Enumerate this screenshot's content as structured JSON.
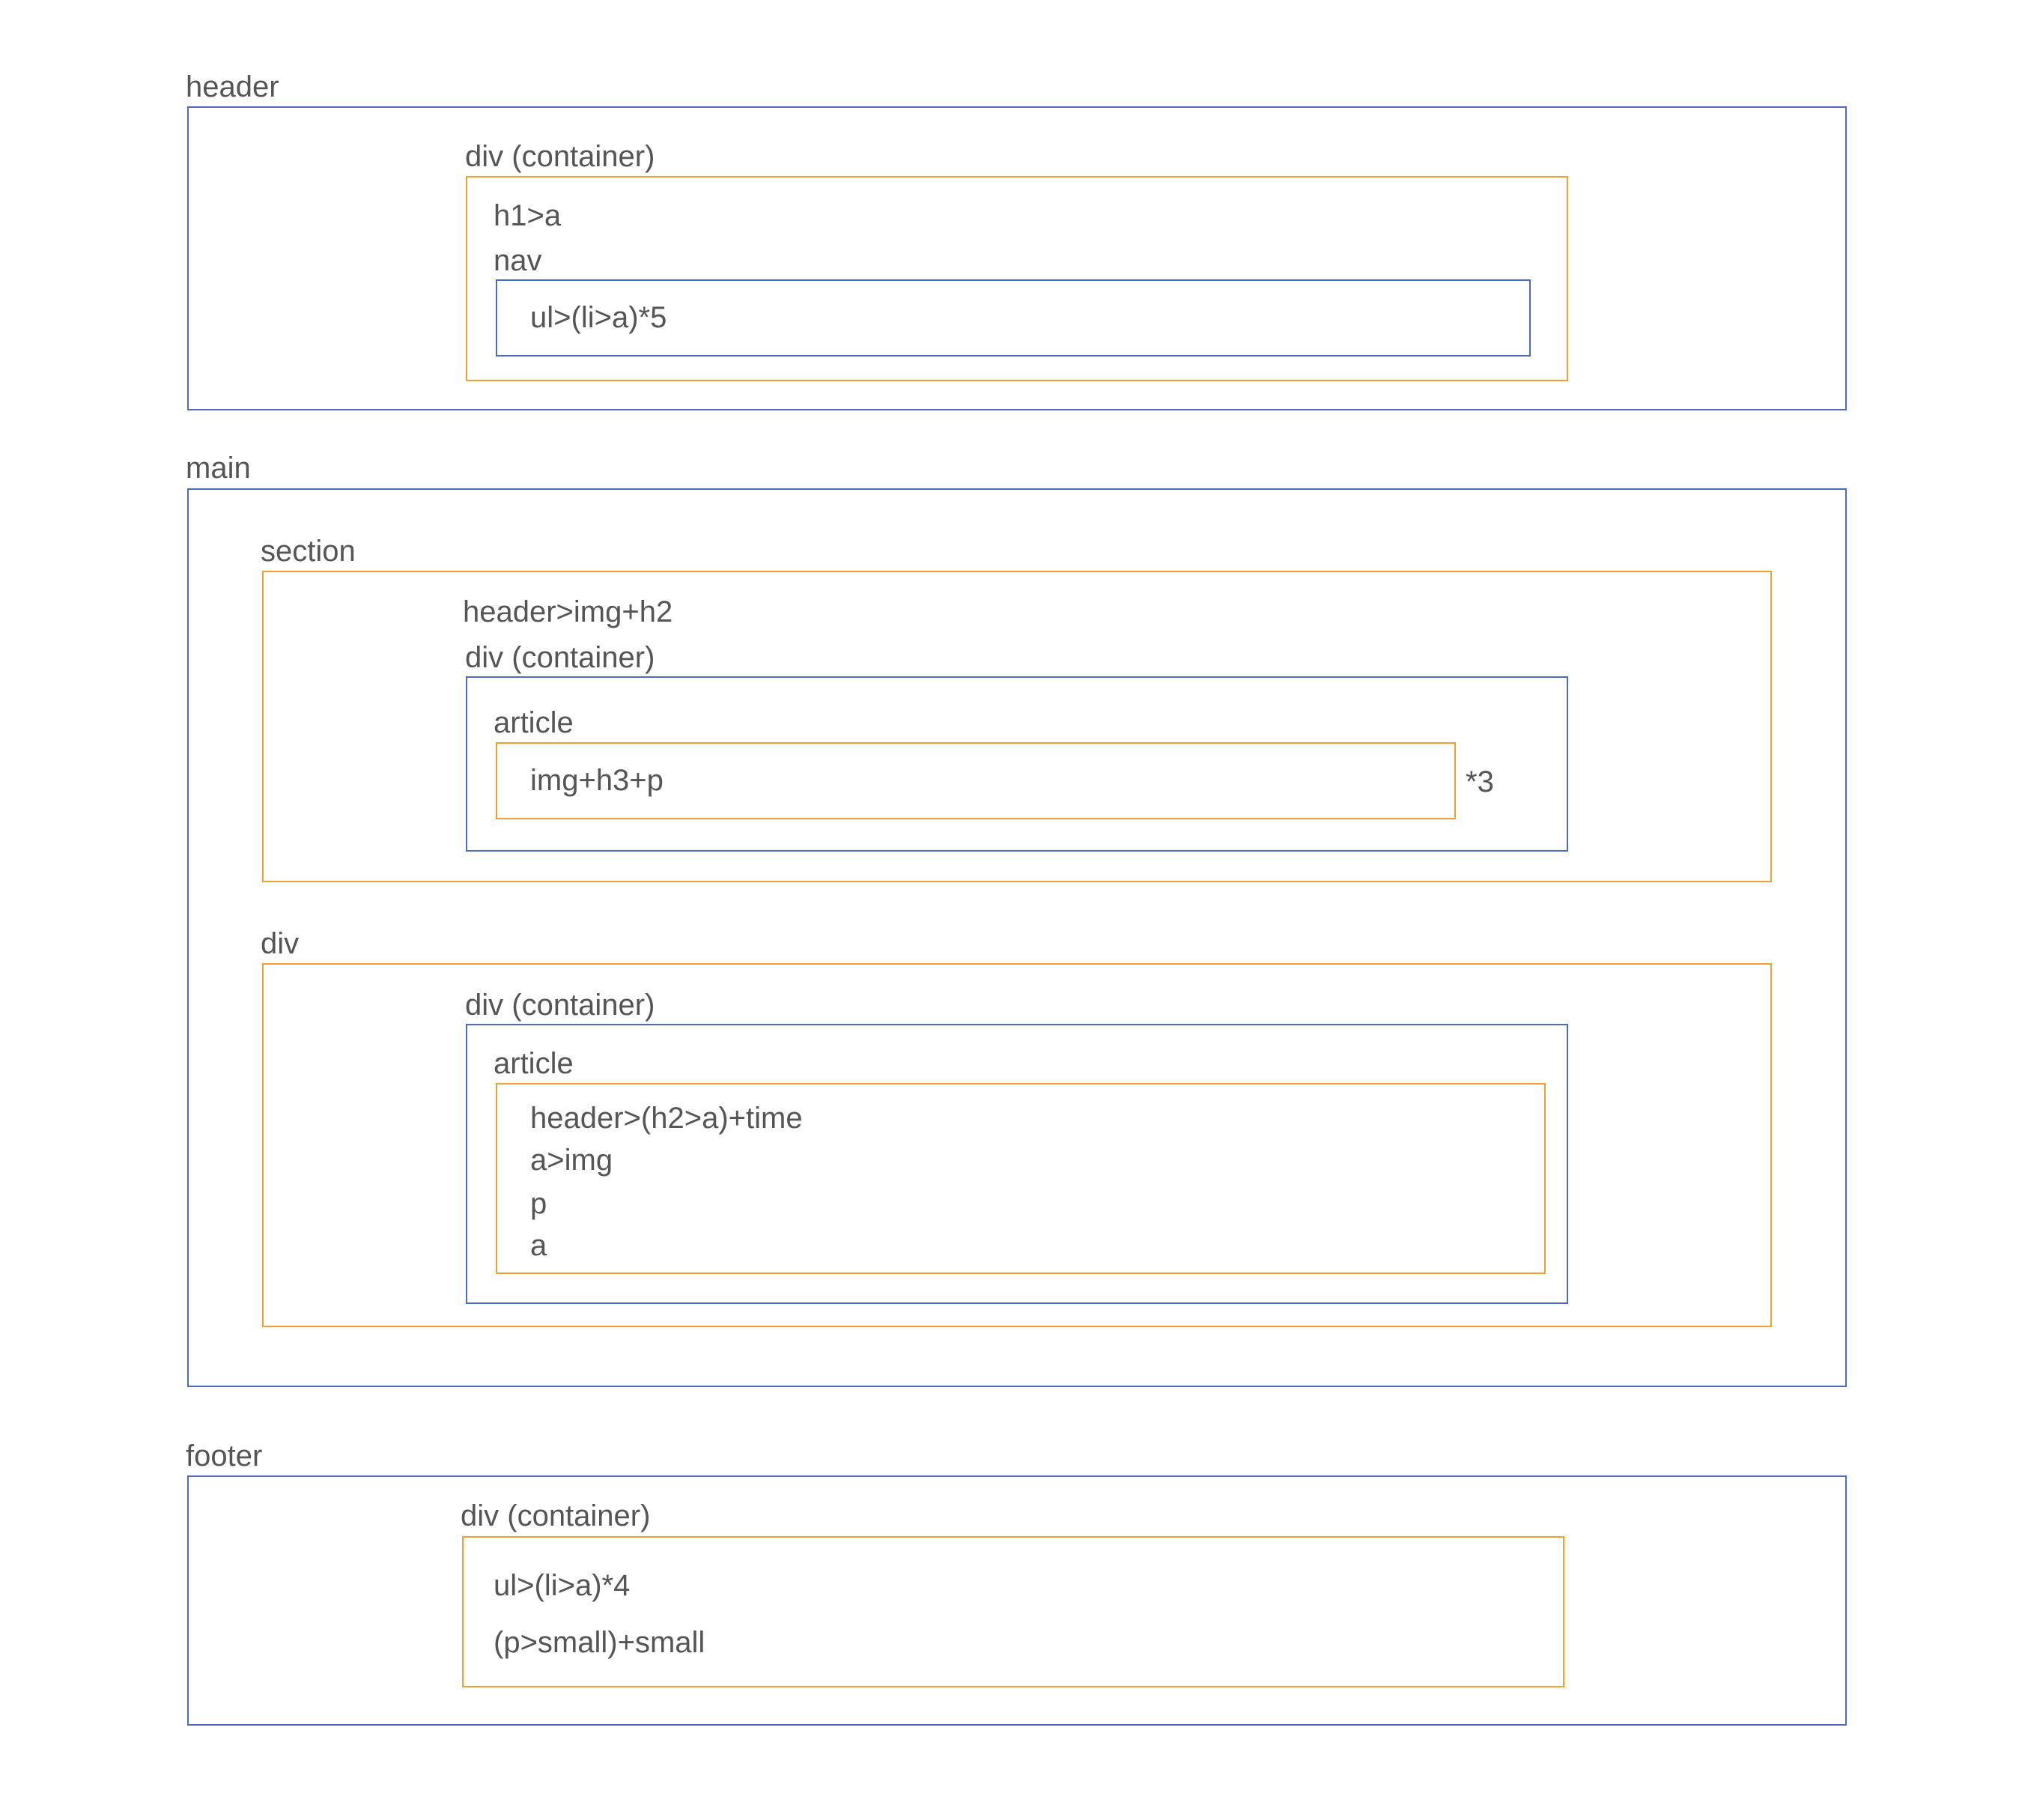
{
  "header": {
    "label": "header",
    "container_label": "div (container)",
    "h1_label": "h1>a",
    "nav_label": "nav",
    "nav_content": "ul>(li>a)*5"
  },
  "main": {
    "label": "main",
    "section": {
      "label": "section",
      "header_label": "header>img+h2",
      "container_label": "div (container)",
      "article_label": "article",
      "article_content": "img+h3+p",
      "repeat": "*3"
    },
    "div": {
      "label": "div",
      "container_label": "div (container)",
      "article_label": "article",
      "article_lines": [
        "header>(h2>a)+time",
        "a>img",
        "p",
        "a"
      ]
    }
  },
  "footer": {
    "label": "footer",
    "container_label": "div (container)",
    "line1": "ul>(li>a)*4",
    "line2": "(p>small)+small"
  },
  "colors": {
    "blue": "#4a6cc0",
    "orange": "#f0a030",
    "text": "#555555"
  }
}
